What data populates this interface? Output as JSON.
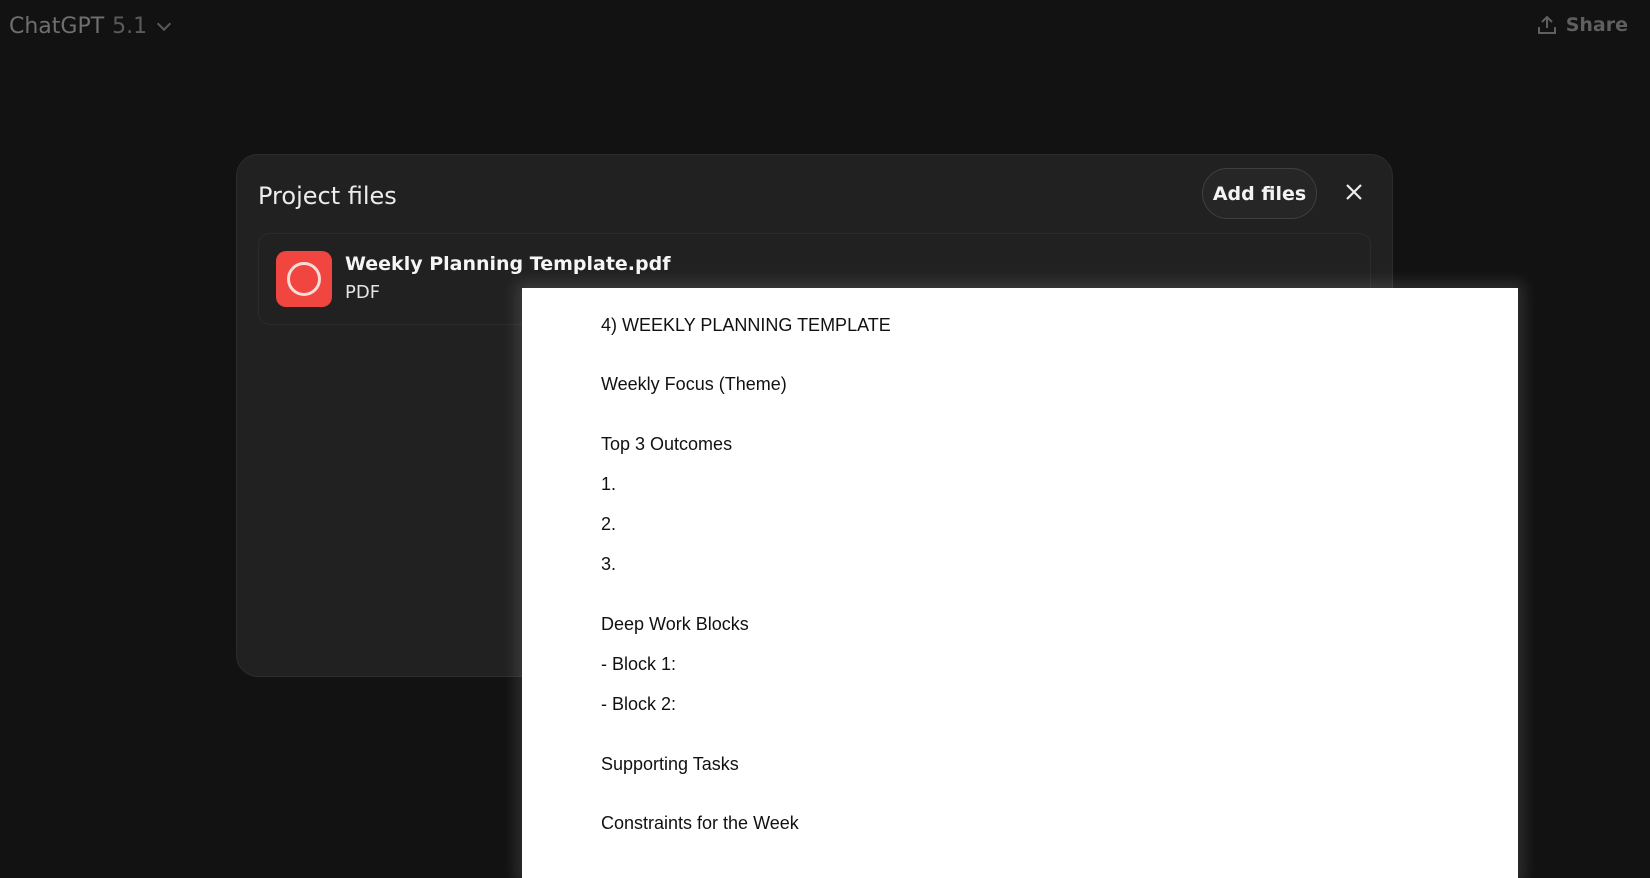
{
  "topbar": {
    "app_name": "ChatGPT",
    "version": "5.1",
    "share_label": "Share"
  },
  "modal": {
    "title": "Project files",
    "add_files_label": "Add files",
    "files": [
      {
        "name": "Weekly Planning Template.pdf",
        "type": "PDF"
      }
    ]
  },
  "preview": {
    "lines": [
      "4) WEEKLY PLANNING TEMPLATE",
      "Weekly Focus (Theme)",
      "Top 3 Outcomes",
      "1.",
      "2.",
      "3.",
      "Deep Work Blocks",
      "- Block 1:",
      "- Block 2:",
      "Supporting Tasks",
      "Constraints for the Week"
    ]
  }
}
